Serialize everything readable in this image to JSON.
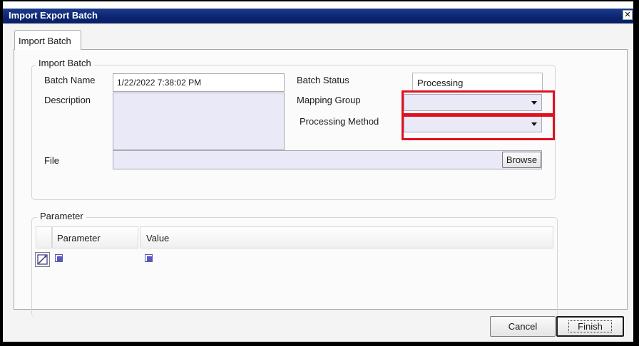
{
  "window": {
    "title": "Import Export Batch",
    "close_glyph": "✕"
  },
  "tabs": [
    {
      "label": "Import Batch"
    }
  ],
  "import_group": {
    "legend": "Import Batch",
    "batch_name": {
      "label": "Batch Name",
      "value": "1/22/2022 7:38:02 PM"
    },
    "description": {
      "label": "Description",
      "value": ""
    },
    "batch_status": {
      "label": "Batch Status",
      "value": "Processing"
    },
    "mapping_group": {
      "label": "Mapping Group",
      "value": ""
    },
    "processing_method": {
      "label": "Processing Method",
      "value": ""
    },
    "file": {
      "label": "File",
      "value": "",
      "browse_label": "Browse"
    }
  },
  "parameter_group": {
    "legend": "Parameter",
    "columns": [
      "Parameter",
      "Value"
    ]
  },
  "footer": {
    "cancel_label": "Cancel",
    "finish_label": "Finish"
  },
  "colors": {
    "titlebar": "#0a2470",
    "highlight": "#e01020",
    "field_bg": "#e9e9f8"
  }
}
